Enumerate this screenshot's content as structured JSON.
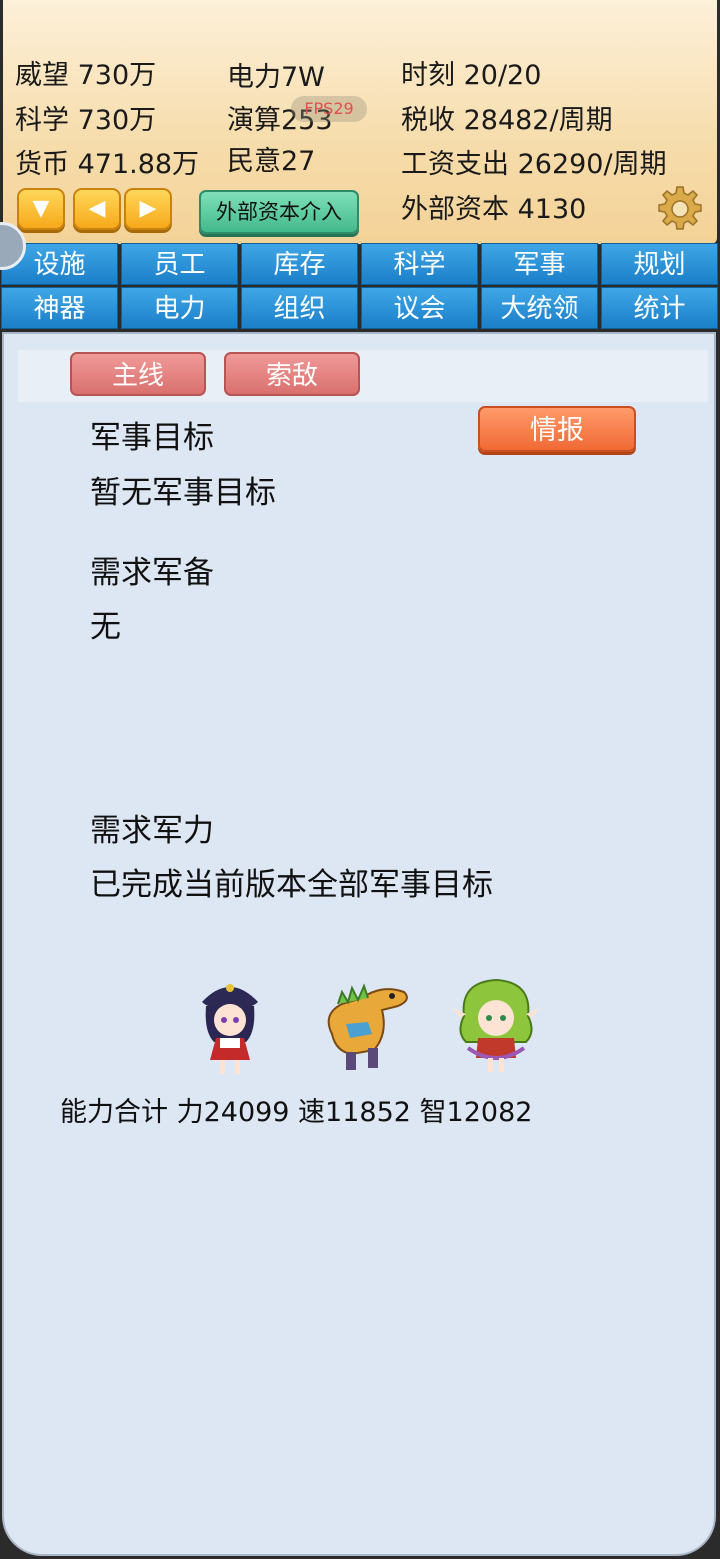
{
  "header": {
    "stats": {
      "prestige": "威望 730万",
      "science": "科学 730万",
      "currency": "货币 471.88万",
      "power": "电力7W",
      "compute": "演算253",
      "morale": "民意27",
      "time": "时刻 20/20",
      "tax": "税收 28482/周期",
      "wage": "工资支出 26290/周期",
      "external_capital": "外部资本 4130"
    },
    "fps": "FPS29",
    "external_capital_button": "外部资本介入",
    "icons": [
      "chevron-down-icon",
      "chevron-left-icon",
      "chevron-right-icon",
      "gear-icon"
    ]
  },
  "tabs": {
    "row1": [
      "设施",
      "员工",
      "库存",
      "科学",
      "军事",
      "规划"
    ],
    "row2": [
      "神器",
      "电力",
      "组织",
      "议会",
      "大统领",
      "统计"
    ]
  },
  "panel": {
    "subtabs": [
      "主线",
      "索敌"
    ],
    "intel_button": "情报",
    "military_goal_title": "军事目标",
    "military_goal_value": "暂无军事目标",
    "required_equipment_title": "需求军备",
    "required_equipment_value": "无",
    "required_force_title": "需求军力",
    "required_force_value": "已完成当前版本全部军事目标",
    "ability_total": "能力合计 力24099 速11852 智12082"
  },
  "colors": {
    "header_bg": "#f6dcab",
    "tab_blue": "#1b7fc9",
    "subtab_red": "#d9706e",
    "intel_orange": "#f06a35",
    "panel_bg": "#dde7f3"
  }
}
